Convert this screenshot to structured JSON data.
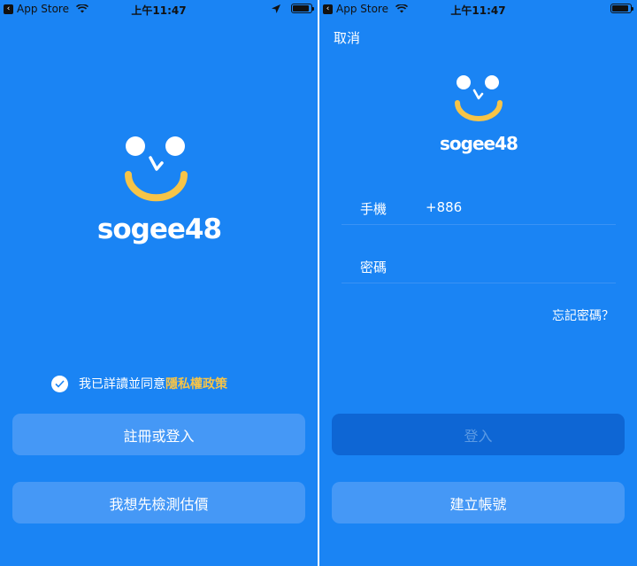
{
  "status_bar": {
    "back_label": "App Store",
    "time": "上午11:47"
  },
  "brand": {
    "logo_text": "sogee48",
    "accent_color": "#f7c447",
    "background_color": "#1a84f4"
  },
  "welcome": {
    "agreement_text": "我已詳讀並同意",
    "privacy_link": "隱私權政策",
    "agreement_checked": true,
    "register_button": "註冊或登入",
    "appraise_button": "我想先檢測估價"
  },
  "login": {
    "cancel": "取消",
    "phone_label": "手機",
    "country_code": "+886",
    "password_label": "密碼",
    "forgot_password": "忘記密碼？",
    "login_button": "登入",
    "create_account_button": "建立帳號"
  }
}
